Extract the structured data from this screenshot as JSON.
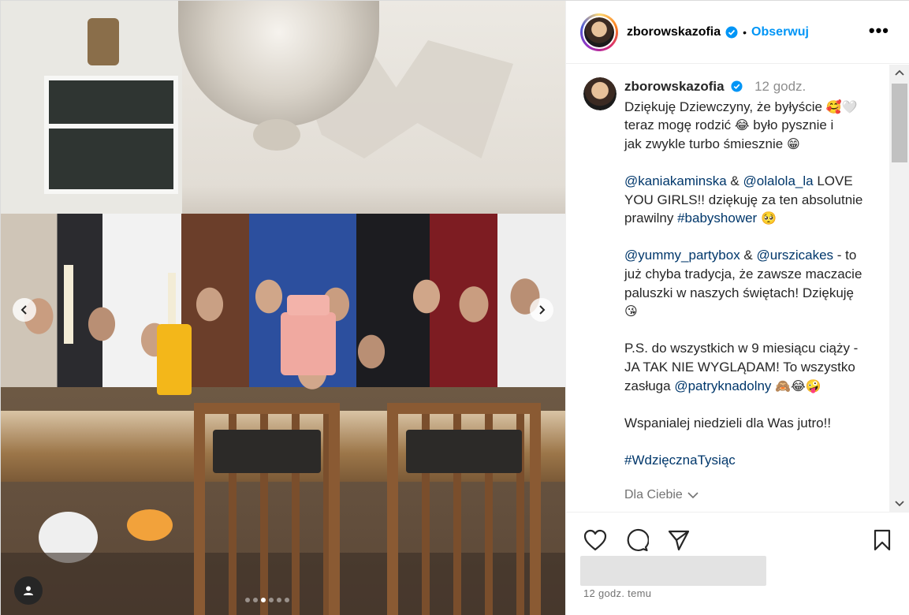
{
  "post": {
    "carousel": {
      "total_slides": 6,
      "active_index": 2
    },
    "prev_icon": "chevron-left-icon",
    "next_icon": "chevron-right-icon",
    "tag_icon": "user-tag-icon"
  },
  "header": {
    "username": "zborowskazofia",
    "verified_icon": "verified-badge-icon",
    "separator": "•",
    "follow_label": "Obserwuj",
    "more_label": "•••"
  },
  "caption": {
    "username": "zborowskazofia",
    "time": "12 godz.",
    "lines": {
      "l1": "Dziękuję Dziewczyny, że byłyście",
      "l1_emoji": "🥰🤍",
      "l2": "teraz mogę rodzić",
      "l2_emoji": "😂",
      "l2_tail": " było pysznie i",
      "l3": "jak zwykle turbo śmiesznie",
      "l3_emoji": "😁",
      "m1": "@kaniakaminska",
      "amp1": " & ",
      "m2": "@olalola_la",
      "l4_tail": " LOVE",
      "l5": "YOU GIRLS!! dziękuję za ten absolutnie",
      "l6": "prawilny ",
      "h1": "#babyshower",
      "l6_emoji": "🥺",
      "m3": "@yummy_partybox",
      "amp2": " & ",
      "m4": "@urszicakes",
      "l7_tail": " - to",
      "l8": "już chyba tradycja, że zawsze maczacie",
      "l9": "paluszki w naszych świętach! Dziękuję",
      "l10_emoji": "😘",
      "l11": "P.S. do wszystkich w 9 miesiącu ciąży -",
      "l12": "JA TAK NIE WYGLĄDAM! To wszystko",
      "l13": "zasługa ",
      "m5": "@patryknadolny",
      "l13_emoji": "🙈😂🤪",
      "l14": "Wspanialej niedzieli dla Was jutro!!",
      "h2": "#WdzięcznaTysiąc"
    },
    "for_you_label": "Dla Ciebie",
    "for_you_icon": "chevron-down-icon"
  },
  "actions": {
    "like_icon": "heart-icon",
    "comment_icon": "comment-icon",
    "share_icon": "send-icon",
    "save_icon": "bookmark-icon",
    "time_ago": "12 godz. temu"
  },
  "colors": {
    "follow": "#0095f6",
    "link": "#00376b",
    "verified": "#0095f6",
    "muted": "#737373"
  }
}
